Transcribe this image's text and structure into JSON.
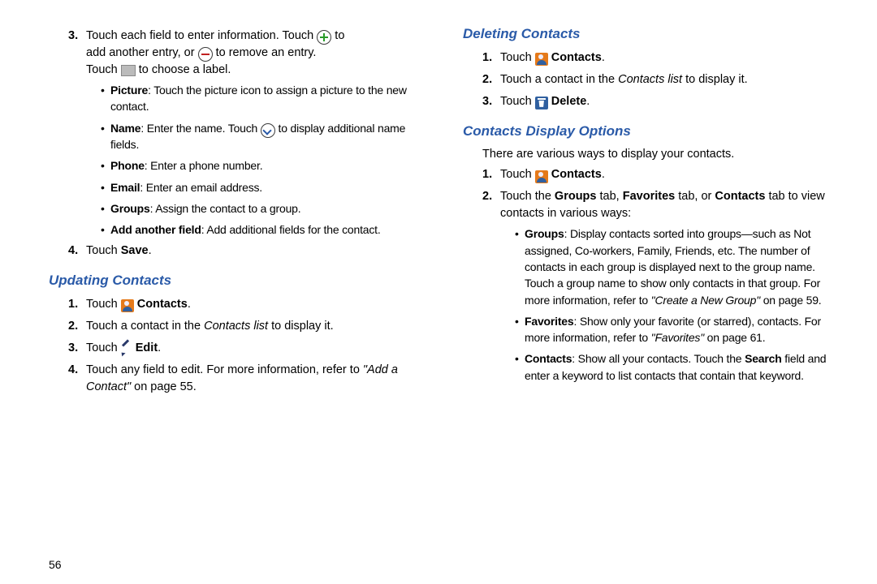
{
  "page_number": "56",
  "left": {
    "step3": {
      "num": "3.",
      "l1a": "Touch each field to enter information. Touch ",
      "l1b": " to",
      "l2a": "add another entry, or ",
      "l2b": " to remove an entry.",
      "l3a": "Touch ",
      "l3b": " to choose a label."
    },
    "bullets": {
      "picture_b": "Picture",
      "picture_t": ": Touch the picture icon to assign a picture to the new contact.",
      "name_b": "Name",
      "name_t1": ": Enter the name. Touch ",
      "name_t2": " to display additional name fields.",
      "phone_b": "Phone",
      "phone_t": ": Enter a phone number.",
      "email_b": "Email",
      "email_t": ": Enter an email address.",
      "groups_b": "Groups",
      "groups_t": ": Assign the contact to a group.",
      "addfield_b": "Add another field",
      "addfield_t": ": Add additional fields for the contact."
    },
    "step4": {
      "num": "4.",
      "t1": "Touch ",
      "t2": "Save",
      "t3": "."
    },
    "heading_update": "Updating Contacts",
    "u1": {
      "num": "1.",
      "t1": "Touch ",
      "t2": "Contacts",
      "t3": "."
    },
    "u2": {
      "num": "2.",
      "t1": "Touch a contact in the ",
      "t2": "Contacts list",
      "t3": " to display it."
    },
    "u3": {
      "num": "3.",
      "t1": "Touch ",
      "t2": "Edit",
      "t3": "."
    },
    "u4": {
      "num": "4.",
      "t1": "Touch any field to edit. For more information, refer to ",
      "t2": "\"Add a Contact\"",
      "t3": " on page 55."
    }
  },
  "right": {
    "heading_delete": "Deleting Contacts",
    "d1": {
      "num": "1.",
      "t1": "Touch ",
      "t2": "Contacts",
      "t3": "."
    },
    "d2": {
      "num": "2.",
      "t1": "Touch a contact in the ",
      "t2": "Contacts list",
      "t3": " to display it."
    },
    "d3": {
      "num": "3.",
      "t1": "Touch ",
      "t2": "Delete",
      "t3": "."
    },
    "heading_display": "Contacts Display Options",
    "intro": "There are various ways to display your contacts.",
    "o1": {
      "num": "1.",
      "t1": "Touch ",
      "t2": "Contacts",
      "t3": "."
    },
    "o2": {
      "num": "2.",
      "t1": "Touch the ",
      "g": "Groups",
      "t2": " tab, ",
      "f": "Favorites",
      "t3": " tab, or ",
      "c": "Contacts",
      "t4": " tab to view contacts in various ways:"
    },
    "ob": {
      "groups_b": "Groups",
      "groups_t1": ": Display contacts sorted into groups—such as Not assigned, Co-workers, Family, Friends, etc. The number of contacts in each group is displayed next to the group name. Touch a group name to show only contacts in that group. For more information, refer to ",
      "groups_i": "\"Create a New Group\"",
      "groups_t2": " on page 59.",
      "fav_b": "Favorites",
      "fav_t1": ": Show only your favorite (or starred), contacts. For more information, refer to ",
      "fav_i": "\"Favorites\"",
      "fav_t2": " on page 61.",
      "con_b": "Contacts",
      "con_t1": ": Show all your contacts. Touch the ",
      "con_s": "Search",
      "con_t2": " field and enter a keyword to list contacts that contain that keyword."
    }
  }
}
